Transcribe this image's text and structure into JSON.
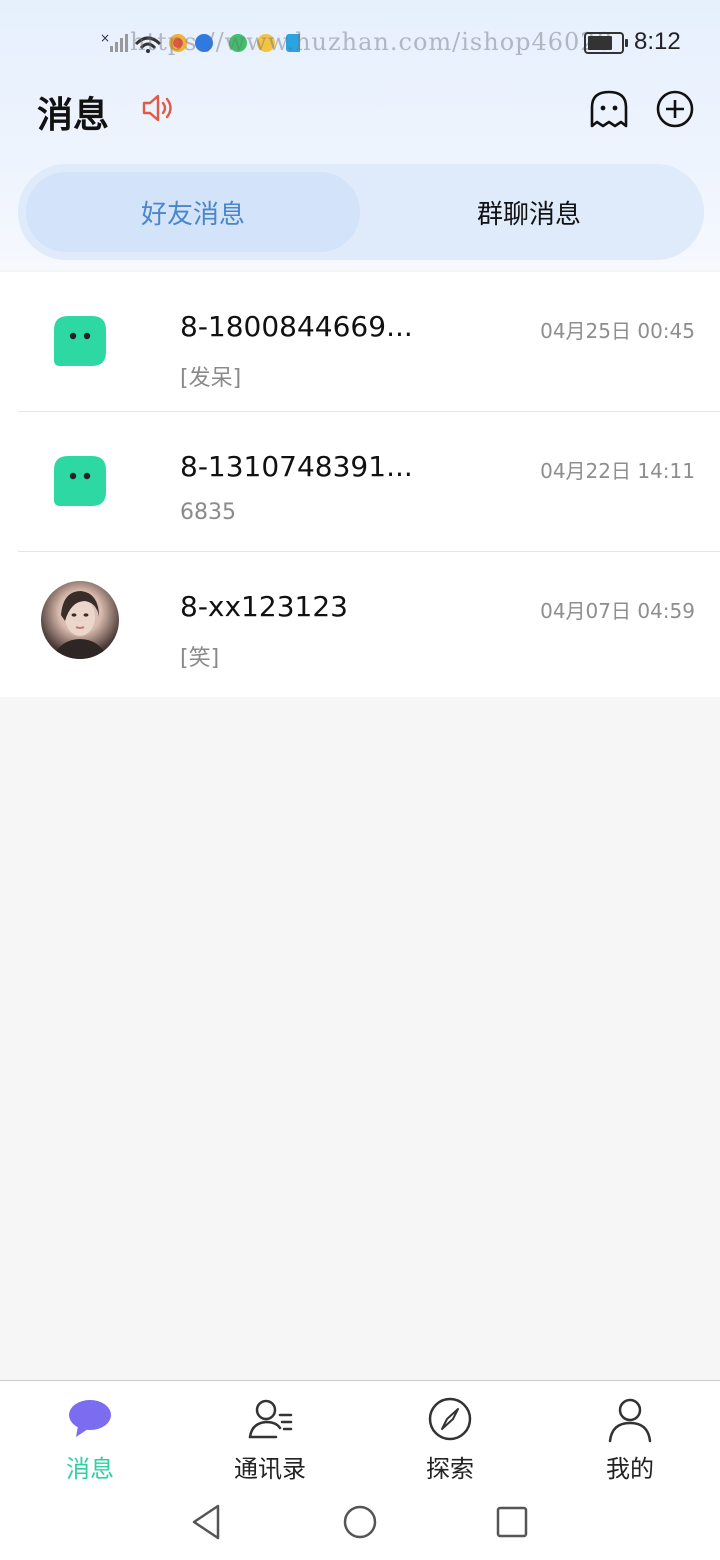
{
  "status_bar": {
    "watermark": "https://www.huzhan.com/ishop46028",
    "time": "8:12"
  },
  "header": {
    "title": "消息",
    "icons": [
      "speaker-icon",
      "ghost-icon",
      "add-icon"
    ]
  },
  "tabs": [
    {
      "label": "好友消息",
      "active": true
    },
    {
      "label": "群聊消息",
      "active": false
    }
  ],
  "conversations": [
    {
      "name": "8-1800844669...",
      "preview": "[发呆]",
      "time": "04月25日 00:45",
      "avatar": "green-bubble"
    },
    {
      "name": "8-1310748391...",
      "preview": "6835",
      "time": "04月22日 14:11",
      "avatar": "green-bubble"
    },
    {
      "name": "8-xx123123",
      "preview": "[笑]",
      "time": "04月07日 04:59",
      "avatar": "photo"
    }
  ],
  "bottom_nav": [
    {
      "label": "消息",
      "icon": "chat-bubble-icon",
      "active": true
    },
    {
      "label": "通讯录",
      "icon": "contacts-icon",
      "active": false
    },
    {
      "label": "探索",
      "icon": "compass-icon",
      "active": false
    },
    {
      "label": "我的",
      "icon": "profile-icon",
      "active": false
    }
  ],
  "colors": {
    "accent_green": "#2ed1a0",
    "tab_active_text": "#4a86c8",
    "chat_icon_purple": "#7b6cf0",
    "speaker_red": "#e05a45"
  }
}
